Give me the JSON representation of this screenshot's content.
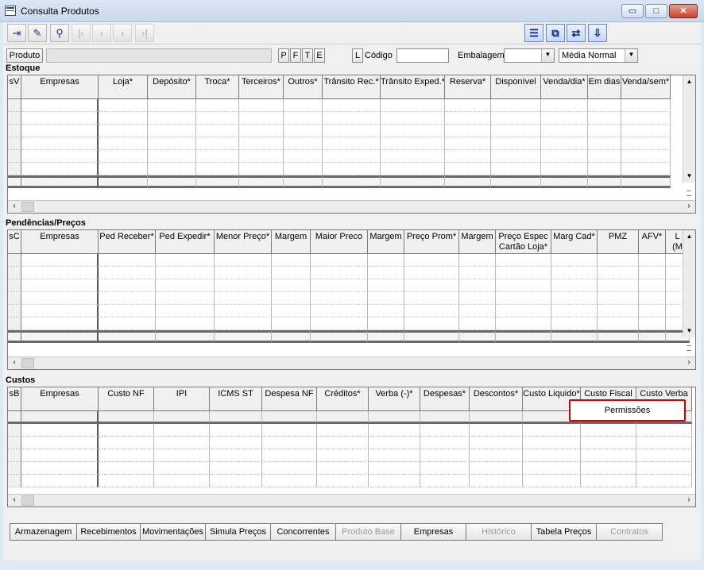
{
  "window": {
    "title": "Consulta Produtos",
    "minimize": "▭",
    "maximize": "□",
    "close": "✕"
  },
  "toolbar": {
    "left_buttons": [
      "exit-icon",
      "eraser-icon",
      "binoculars-icon",
      "first-icon",
      "prev-icon",
      "next-icon",
      "last-icon"
    ],
    "right_buttons": [
      "grid-view-icon",
      "copy-view-icon",
      "export-view-icon",
      "import-view-icon"
    ]
  },
  "filters": {
    "produto_label": "Produto",
    "produto_value": "",
    "flags": [
      "P",
      "F",
      "T",
      "E"
    ],
    "l_button": "L",
    "codigo_label": "Código",
    "codigo_value": "",
    "embalagem_label": "Embalagem",
    "embalagem_value": "",
    "media_value": "Média Normal"
  },
  "estoque": {
    "title": "Estoque",
    "columns": [
      "sV",
      "Empresas",
      "Loja*",
      "Depósito*",
      "Troca*",
      "Terceiros*",
      "Outros*",
      "Trânsito Rec.*",
      "Trânsito Exped.*",
      "Reserva*",
      "Disponível",
      "Venda/dia*",
      "Em dias",
      "Venda/sem*"
    ]
  },
  "pendencias": {
    "title": "Pendências/Preços",
    "columns": [
      "sC",
      "Empresas",
      "Ped Receber*",
      "Ped Expedir*",
      "Menor Preço*",
      "Margem",
      "Maior Preco",
      "Margem",
      "Preço Prom*",
      "Margem",
      "Preço Espec\nCartão Loja*",
      "Marg Cad*",
      "PMZ",
      "AFV*",
      "L\n(M"
    ]
  },
  "custos": {
    "title": "Custos",
    "columns": [
      "sB",
      "Empresas",
      "Custo NF",
      "IPI",
      "ICMS ST",
      "Despesa NF",
      "Créditos*",
      "Verba (-)*",
      "Despesas*",
      "Descontos*",
      "Custo Liquido*",
      "Custo Fiscal",
      "Custo Verba"
    ]
  },
  "context_menu": {
    "item": "Permissões"
  },
  "bottom_tabs": [
    {
      "label": "Armazenagem",
      "enabled": true
    },
    {
      "label": "Recebimentos",
      "enabled": true
    },
    {
      "label": "Movimentações",
      "enabled": true
    },
    {
      "label": "Simula Preços",
      "enabled": true
    },
    {
      "label": "Concorrentes",
      "enabled": true
    },
    {
      "label": "Produto Base",
      "enabled": false
    },
    {
      "label": "Empresas",
      "enabled": true
    },
    {
      "label": "Histórico",
      "enabled": false
    },
    {
      "label": "Tabela Preços",
      "enabled": true
    },
    {
      "label": "Contratos",
      "enabled": false
    }
  ]
}
